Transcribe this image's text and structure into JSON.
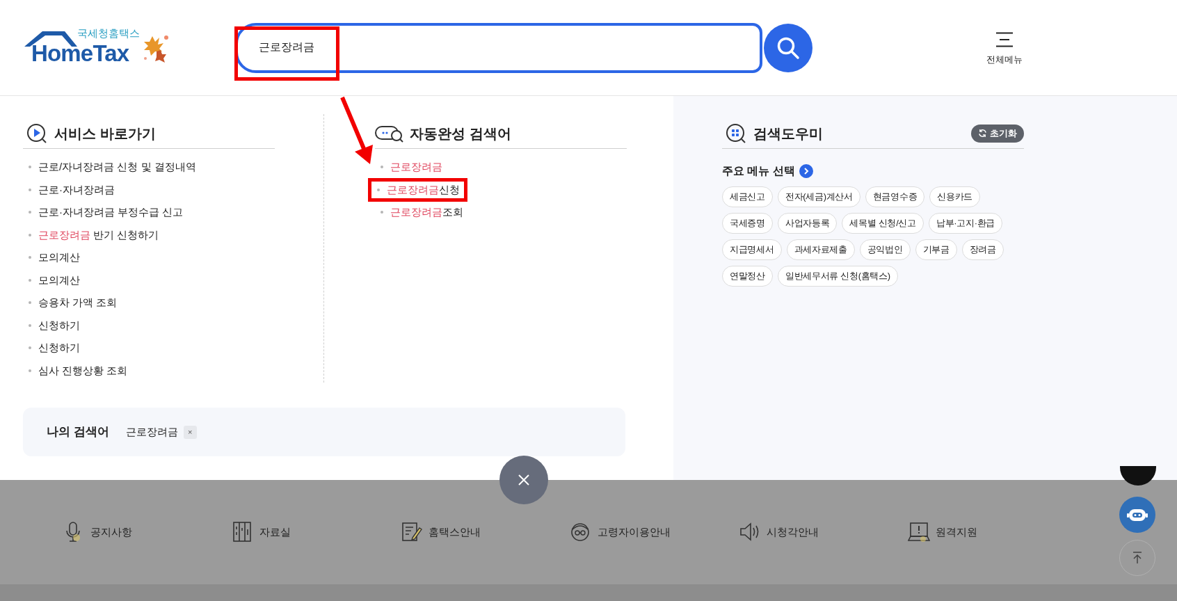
{
  "logo": {
    "subtitle": "국세청홈택스",
    "title": "HomeTax"
  },
  "search": {
    "value": "근로장려금"
  },
  "menu_button": {
    "label": "전체메뉴"
  },
  "service_shortcuts": {
    "title": "서비스 바로가기",
    "items": [
      {
        "text": "근로/자녀장려금 신청 및 결정내역"
      },
      {
        "text": "근로·자녀장려금"
      },
      {
        "text": "근로·자녀장려금 부정수급 신고"
      },
      {
        "highlight": "근로장려금",
        "text": " 반기 신청하기"
      },
      {
        "text": "모의계산"
      },
      {
        "text": "모의계산"
      },
      {
        "text": "승용차 가액 조회"
      },
      {
        "text": "신청하기"
      },
      {
        "text": "신청하기"
      },
      {
        "text": "심사 진행상황 조회"
      }
    ]
  },
  "autocomplete": {
    "title": "자동완성 검색어",
    "items": [
      {
        "highlight": "근로장려금"
      },
      {
        "highlight": "근로장려금",
        "text": "신청"
      },
      {
        "highlight": "근로장려금",
        "text": "조회"
      }
    ]
  },
  "my_searches": {
    "label": "나의 검색어",
    "tags": [
      {
        "text": "근로장려금",
        "remove": "×"
      }
    ]
  },
  "search_helper": {
    "title": "검색도우미",
    "reset_button": "초기화",
    "section_title": "주요 메뉴 선택",
    "chips": [
      "세금신고",
      "전자(세금)계산서",
      "현금영수증",
      "신용카드",
      "국세증명",
      "사업자등록",
      "세목별 신청/신고",
      "납부·고지·환급",
      "지급명세서",
      "과세자료제출",
      "공익법인",
      "기부금",
      "장려금",
      "연말정산",
      "일반세무서류 신청(홈택스)"
    ]
  },
  "footer_links": [
    {
      "kind": "microphone",
      "label": "공지사항"
    },
    {
      "kind": "cabinet",
      "label": "자료실"
    },
    {
      "kind": "document",
      "label": "홈택스안내"
    },
    {
      "kind": "elder",
      "label": "고령자이용안내"
    },
    {
      "kind": "speaker",
      "label": "시청각안내"
    },
    {
      "kind": "monitor",
      "label": "원격지원"
    }
  ]
}
